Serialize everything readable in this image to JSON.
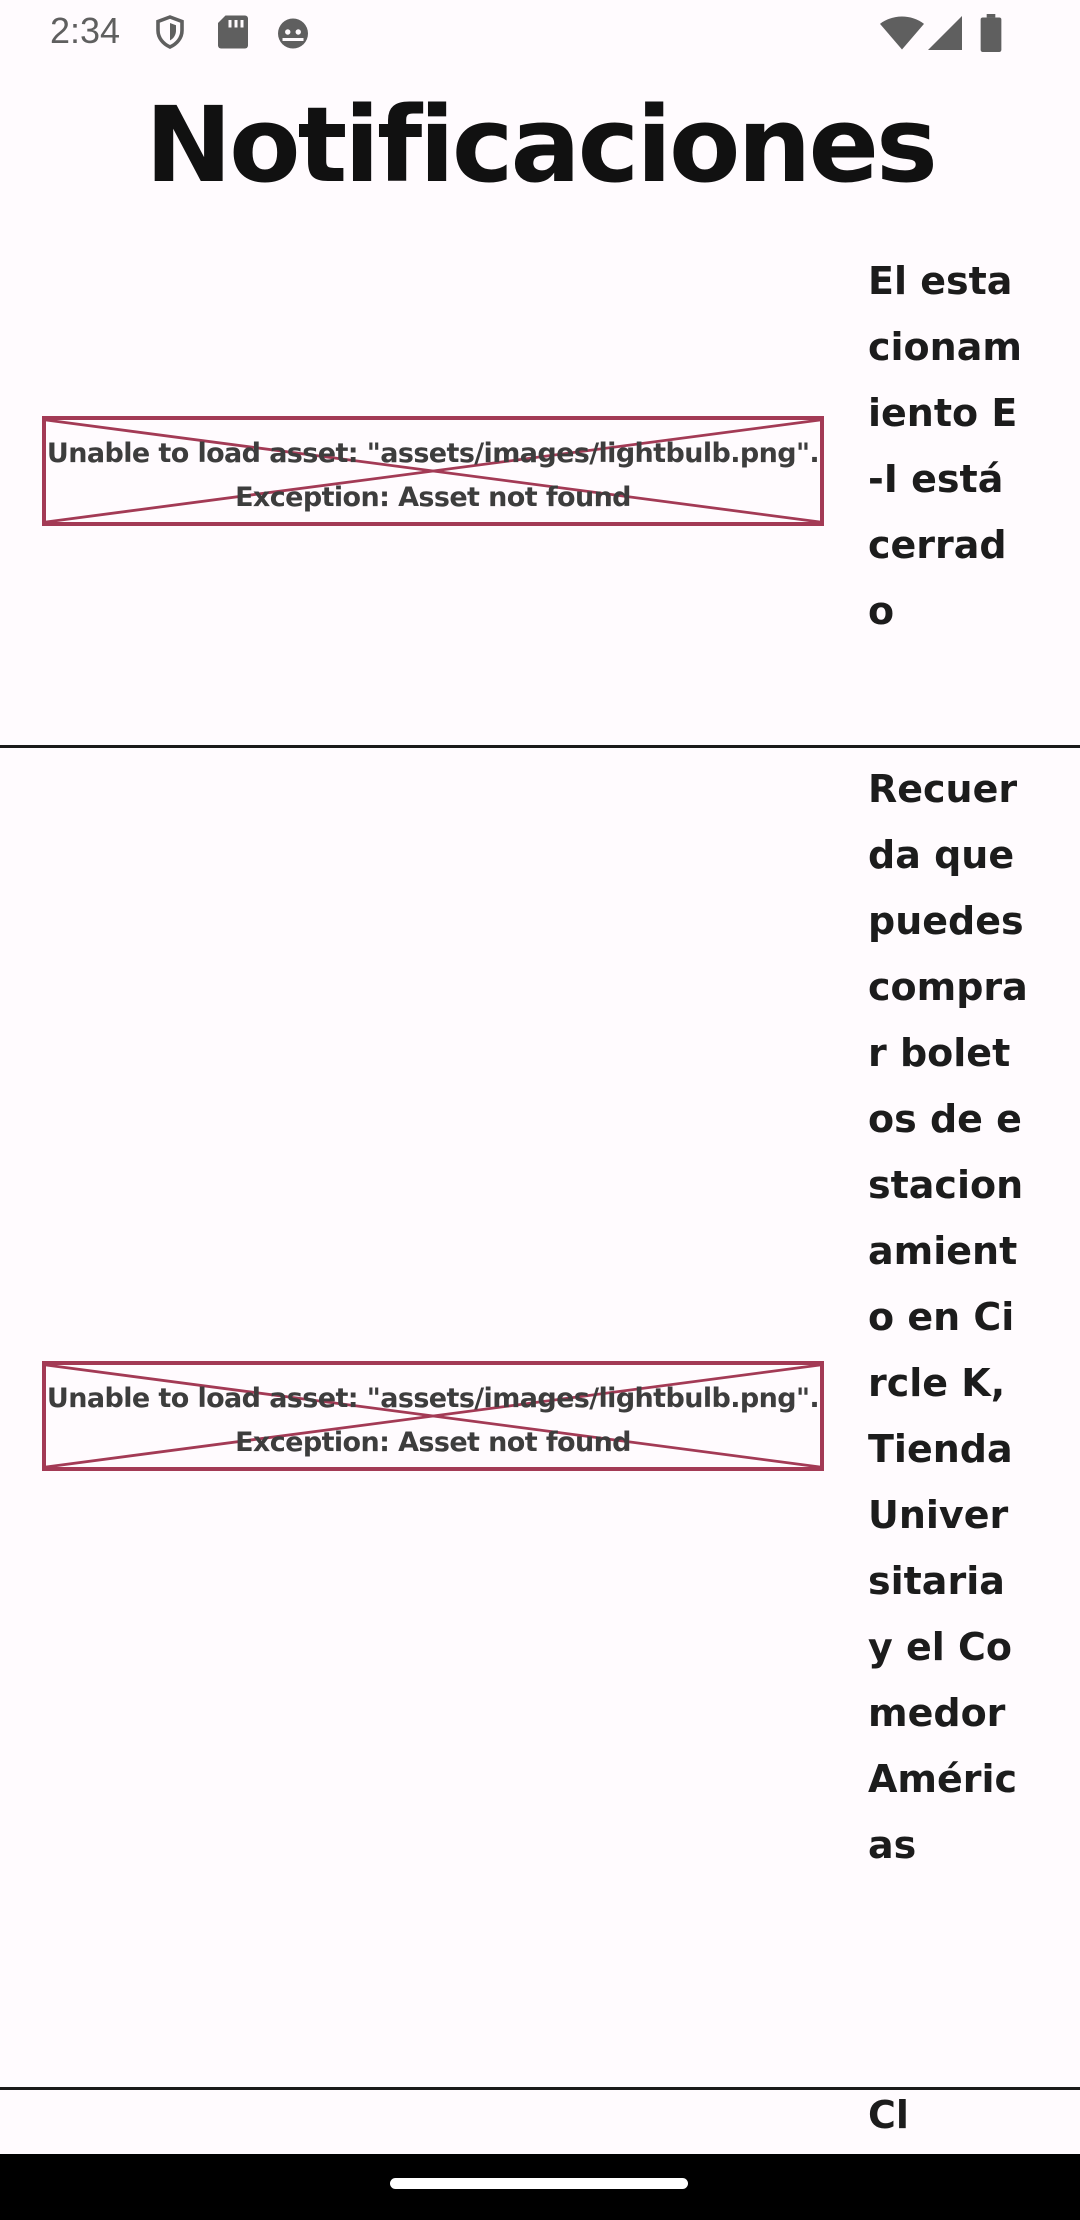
{
  "status_bar": {
    "time": "2:34",
    "left_icons": [
      "shield-icon",
      "sd-card-icon",
      "android-head-icon"
    ],
    "right_icons": [
      "wifi-icon",
      "cell-signal-icon",
      "battery-icon"
    ]
  },
  "page": {
    "title": "Notificaciones"
  },
  "notifications": [
    {
      "image_error_line1": "Unable to load asset: \"assets/images/lightbulb.png\".",
      "image_error_line2": "Exception: Asset not found",
      "text": "El estacionamiento E-I está cerrado"
    },
    {
      "image_error_line1": "Unable to load asset: \"assets/images/lightbulb.png\".",
      "image_error_line2": "Exception: Asset not found",
      "text": "Recuerda que puedes comprar boletos de estacionamiento en Circle K, Tienda Universitaria y el Comedor Américas"
    },
    {
      "text": "Cl"
    }
  ],
  "colors": {
    "background": "#fffbfe",
    "error_border": "#a33a55",
    "divider": "#1a1a1a",
    "nav_bar": "#000000"
  }
}
